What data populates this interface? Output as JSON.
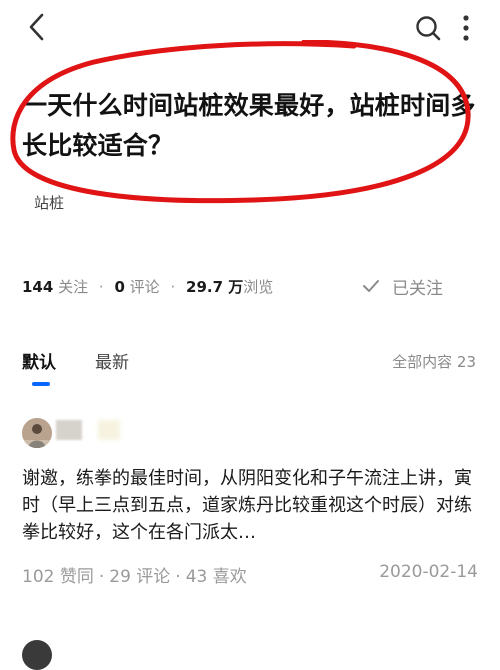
{
  "question": {
    "title": "一天什么时间站桩效果最好，站桩时间多长比较适合？",
    "topic": "站桩"
  },
  "stats": {
    "followers": "144",
    "followers_label": "关注",
    "comments": "0",
    "comments_label": "评论",
    "views": "29.7 万",
    "views_label": "浏览",
    "follow_status": "已关注"
  },
  "tabs": {
    "default": "默认",
    "latest": "最新",
    "total": "全部内容 23"
  },
  "answer": {
    "excerpt": "谢邀，练拳的最佳时间，从阴阳变化和子午流注上讲，寅时（早上三点到五点，道家炼丹比较重视这个时辰）对练拳比较好，这个在各门派太…",
    "upvotes": "102 赞同",
    "comments": "29 评论",
    "likes": "43 喜欢",
    "date": "2020-02-14"
  },
  "colors": {
    "accent": "#0a66ff",
    "annotation": "#e01414"
  },
  "icons": [
    "back-arrow-icon",
    "search-icon",
    "more-vertical-icon",
    "check-icon"
  ]
}
